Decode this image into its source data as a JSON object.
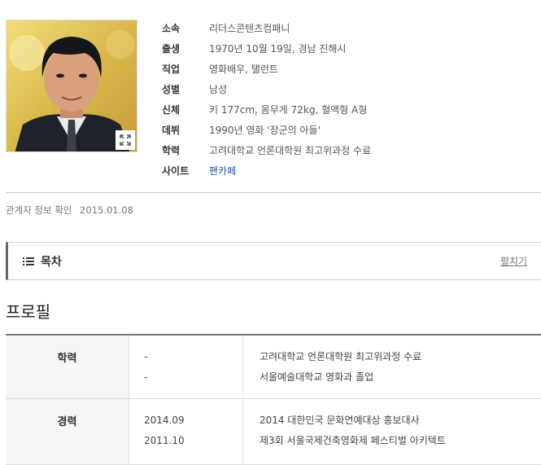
{
  "profile": {
    "rows": [
      {
        "label": "소속",
        "value": "리더스콘텐츠컴패니"
      },
      {
        "label": "출생",
        "value": "1970년 10월 19일, 경남 진해시"
      },
      {
        "label": "직업",
        "value": "영화배우, 탤런트"
      },
      {
        "label": "성별",
        "value": "남성"
      },
      {
        "label": "신체",
        "value": "키 177cm, 몸무게 72kg, 혈액형 A형"
      },
      {
        "label": "데뷔",
        "value": "1990년 영화 '장군의 아들'"
      },
      {
        "label": "학력",
        "value": "고려대학교 언론대학원 최고위과정 수료"
      },
      {
        "label": "사이트",
        "value": "팬카페"
      }
    ]
  },
  "confirm": {
    "label": "관계자 정보 확인",
    "date": "2015.01.08"
  },
  "toc": {
    "title": "목차",
    "toggle": "펼치기"
  },
  "section_title": "프로필",
  "table": [
    {
      "header": "학력",
      "dates": [
        "-",
        "-"
      ],
      "texts": [
        "고려대학교 언론대학원 최고위과정 수료",
        "서울예술대학교 영화과 졸업"
      ]
    },
    {
      "header": "경력",
      "dates": [
        "2014.09",
        "2011.10"
      ],
      "texts": [
        "2014 대한민국 문화연예대상 홍보대사",
        "제3회 서울국제건축영화제 페스티벌 아키텍트"
      ]
    }
  ],
  "icons": {
    "expand": "expand-icon",
    "list": "list-icon"
  },
  "colors": {
    "link": "#2255aa",
    "toc_border": "#666666",
    "header_bg": "#f6f6f6"
  }
}
